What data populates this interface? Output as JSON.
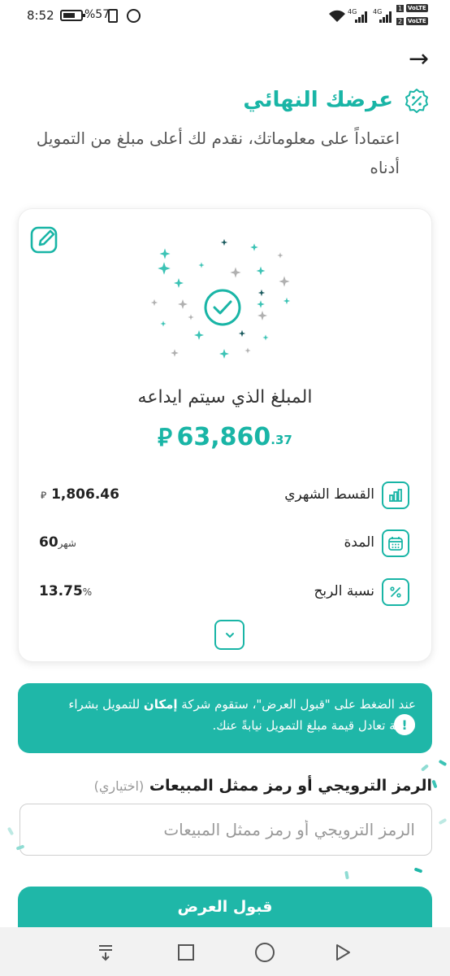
{
  "status_bar": {
    "time": "8:52",
    "battery": "%57",
    "network_1": "4G",
    "network_2": "4G",
    "sim_1": "1",
    "sim_2": "2",
    "volte_1": "VoLTE",
    "volte_2": "VoLTE"
  },
  "header": {
    "title": "عرضك النهائي",
    "subtitle": "اعتماداً على معلوماتك، نقدم لك أعلى مبلغ من التمويل أدناه"
  },
  "offer": {
    "deposit_label": "المبلغ الذي سيتم ايداعه",
    "deposit_amount": "63,860",
    "deposit_decimals": ".37",
    "currency_symbol": "⃁"
  },
  "details": [
    {
      "label": "القسط الشهري",
      "value": "1,806.46",
      "unit": "⃁",
      "icon": "chart-bars-icon"
    },
    {
      "label": "المدة",
      "value": "60",
      "unit": "شهر",
      "icon": "calendar-icon"
    },
    {
      "label": "نسبة الربح",
      "value": "13.75",
      "unit": "%",
      "icon": "percent-icon"
    }
  ],
  "notice": {
    "text_before": "عند الضغط على \"قبول العرض\"، ستقوم شركة ",
    "company": "إمكان",
    "text_after": " للتمويل بشراء سلعة تعادل قيمة مبلغ التمويل نيابةً عنك."
  },
  "promo": {
    "label": "الرمز الترويجي أو رمز ممثل المبيعات",
    "optional": "(اختياري)",
    "placeholder": "الرمز الترويجي أو رمز ممثل المبيعات",
    "value": ""
  },
  "accept_button": "قبول العرض",
  "colors": {
    "accent": "#1fb7a8",
    "accent_text": "#19b5a6",
    "dark_sparkle": "#1a5a5e",
    "gray_sparkle": "#b0b0b0"
  }
}
